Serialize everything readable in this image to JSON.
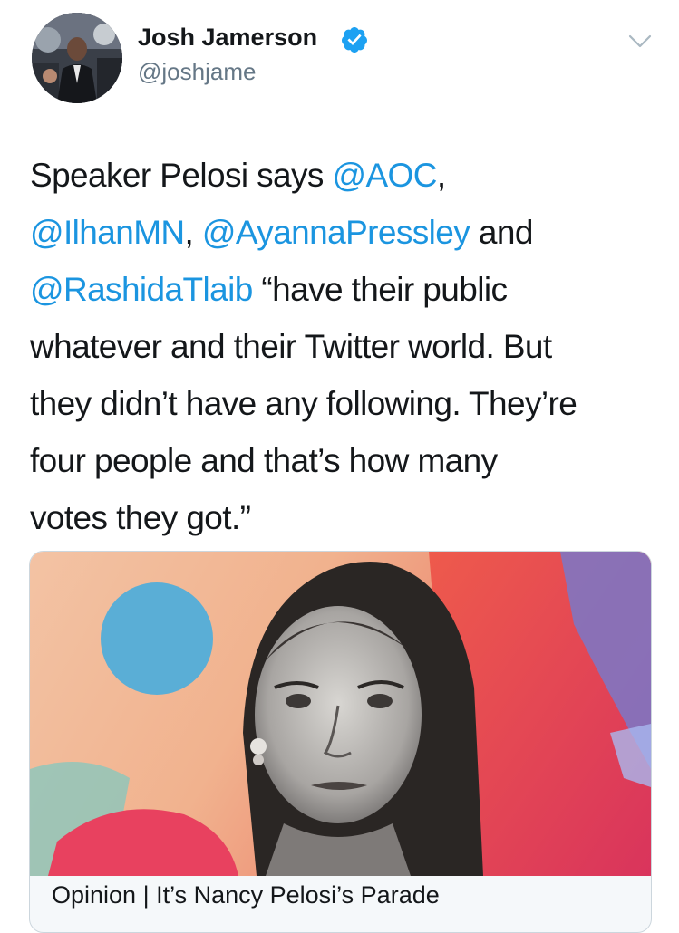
{
  "user": {
    "name": "Josh Jamerson",
    "handle": "@joshjame"
  },
  "tweet": {
    "lines": [
      [
        {
          "text": "Speaker Pelosi says "
        },
        {
          "text": "@AOC",
          "mention": true
        },
        {
          "text": ","
        }
      ],
      [
        {
          "text": "@IlhanMN",
          "mention": true
        },
        {
          "text": ", "
        },
        {
          "text": "@AyannaPressley",
          "mention": true
        },
        {
          "text": " and"
        }
      ],
      [
        {
          "text": "@RashidaTlaib",
          "mention": true
        },
        {
          "text": " “have their public"
        }
      ],
      [
        {
          "text": "whatever and their Twitter world. But"
        }
      ],
      [
        {
          "text": "they didn’t have any following. They’re"
        }
      ],
      [
        {
          "text": "four people and that’s how many"
        }
      ],
      [
        {
          "text": "votes they got.”"
        }
      ]
    ]
  },
  "card": {
    "title": "Opinion | It’s Nancy Pelosi’s Parade"
  },
  "colors": {
    "mention": "#1b95e0",
    "verified": "#1da1f2",
    "secondary_text": "#657786"
  },
  "icons": {
    "verified": "verified-badge-icon",
    "menu": "chevron-down-icon"
  }
}
